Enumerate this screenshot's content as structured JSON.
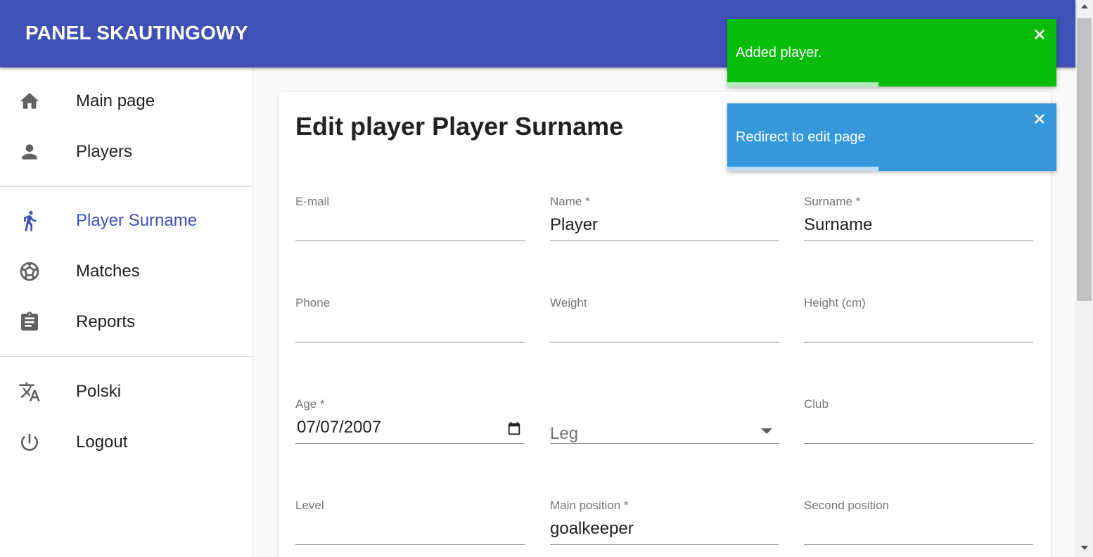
{
  "app": {
    "title": "PANEL SKAUTINGOWY"
  },
  "sidebar": {
    "items": [
      {
        "label": "Main page",
        "icon": "home-icon"
      },
      {
        "label": "Players",
        "icon": "person-icon"
      },
      {
        "label": "Player Surname",
        "icon": "run-icon",
        "active": true
      },
      {
        "label": "Matches",
        "icon": "soccer-ball-icon"
      },
      {
        "label": "Reports",
        "icon": "clipboard-icon"
      },
      {
        "label": "Polski",
        "icon": "translate-icon"
      },
      {
        "label": "Logout",
        "icon": "power-icon"
      }
    ]
  },
  "form": {
    "title": "Edit player Player Surname",
    "fields": {
      "email": {
        "label": "E-mail",
        "value": ""
      },
      "name": {
        "label": "Name *",
        "value": "Player"
      },
      "surname": {
        "label": "Surname *",
        "value": "Surname"
      },
      "phone": {
        "label": "Phone",
        "value": ""
      },
      "weight": {
        "label": "Weight",
        "value": ""
      },
      "height": {
        "label": "Height (cm)",
        "value": ""
      },
      "age": {
        "label": "Age *",
        "value": "07/07/2007"
      },
      "leg": {
        "label": "",
        "placeholder": "Leg"
      },
      "club": {
        "label": "Club",
        "value": ""
      },
      "level": {
        "label": "Level",
        "value": ""
      },
      "main_position": {
        "label": "Main position *",
        "value": "goalkeeper"
      },
      "second_position": {
        "label": "Second position",
        "value": ""
      }
    }
  },
  "toasts": [
    {
      "message": "Added player.",
      "type": "success",
      "color": "#08bc0a",
      "progress": 0.46
    },
    {
      "message": "Redirect to edit page",
      "type": "info",
      "color": "#3498db",
      "progress": 0.46
    }
  ],
  "colors": {
    "primary": "#3f51b5",
    "success": "#08bc0a",
    "info": "#3498db"
  }
}
